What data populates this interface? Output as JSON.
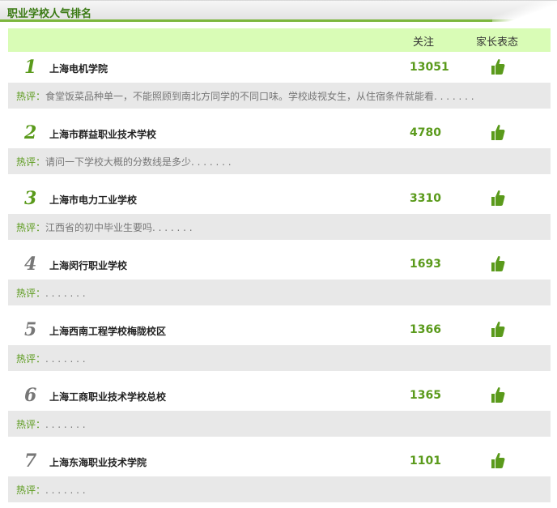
{
  "panel": {
    "title": "职业学校人气排名"
  },
  "columns": {
    "follow": "关注",
    "parent_attitude": "家长表态"
  },
  "rows": [
    {
      "rank": "1",
      "school": "上海电机学院",
      "count": "13051",
      "comment_label": "热评：",
      "comment": "食堂饭菜品种单一，不能照顾到南北方同学的不同口味。学校歧视女生，从住宿条件就能看. . . . . . ."
    },
    {
      "rank": "2",
      "school": "上海市群益职业技术学校",
      "count": "4780",
      "comment_label": "热评：",
      "comment": "请问一下学校大概的分数线是多少. . . . . . ."
    },
    {
      "rank": "3",
      "school": "上海市电力工业学校",
      "count": "3310",
      "comment_label": "热评：",
      "comment": "江西省的初中毕业生要吗. . . . . . ."
    },
    {
      "rank": "4",
      "school": "上海闵行职业学校",
      "count": "1693",
      "comment_label": "热评：",
      "comment": ". . . . . . ."
    },
    {
      "rank": "5",
      "school": "上海西南工程学校梅陇校区",
      "count": "1366",
      "comment_label": "热评：",
      "comment": ". . . . . . ."
    },
    {
      "rank": "6",
      "school": "上海工商职业技术学校总校",
      "count": "1365",
      "comment_label": "热评：",
      "comment": ". . . . . . ."
    },
    {
      "rank": "7",
      "school": "上海东海职业技术学院",
      "count": "1101",
      "comment_label": "热评：",
      "comment": ". . . . . . ."
    }
  ],
  "icons": {
    "thumb": "thumbs-up-icon"
  },
  "colors": {
    "accent_green": "#5a9a1b",
    "header_band": "#d9fcb6",
    "comment_bg": "#e8e8e8",
    "rank_gray": "#777777"
  }
}
